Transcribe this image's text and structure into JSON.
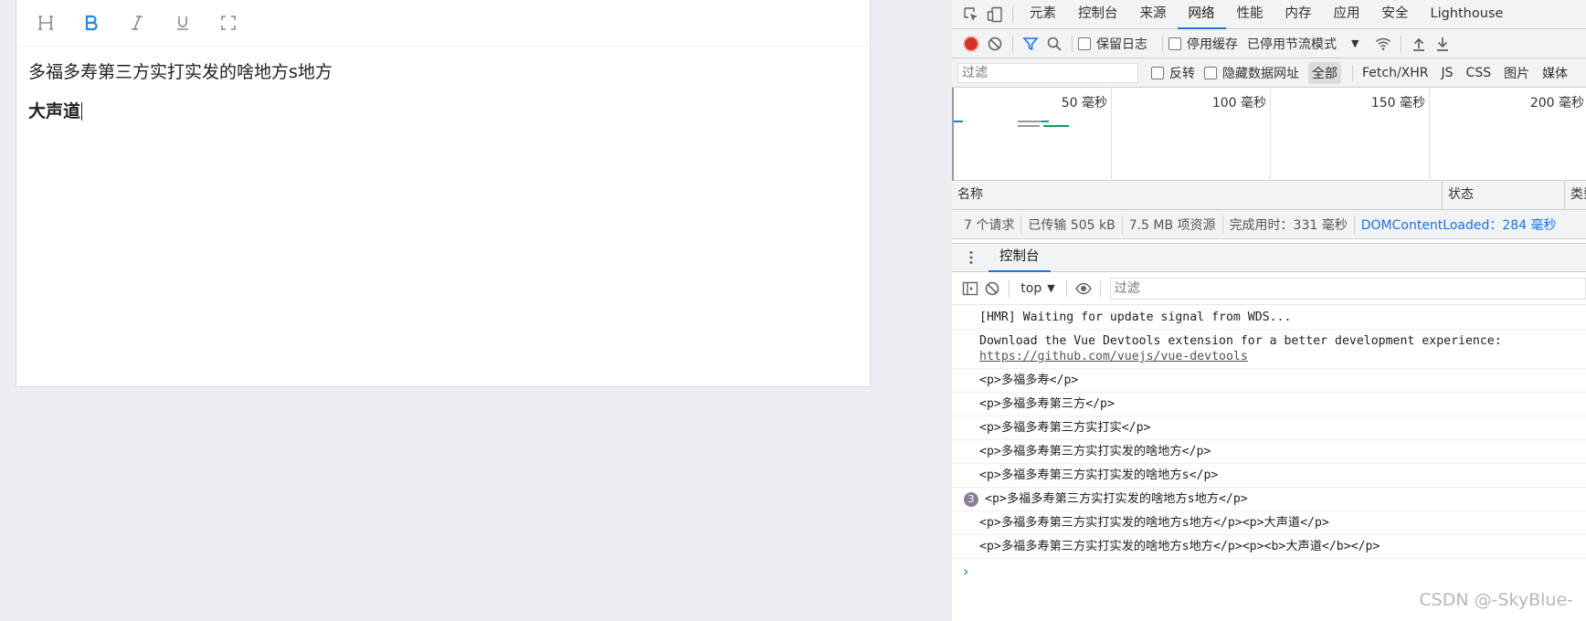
{
  "editor": {
    "toolbar": [
      {
        "icon": "heading-icon",
        "color": "#888888",
        "active": false
      },
      {
        "icon": "bold-icon",
        "color": "#1e88e5",
        "active": true
      },
      {
        "icon": "italic-icon",
        "color": "#888888",
        "active": false
      },
      {
        "icon": "underline-icon",
        "color": "#888888",
        "active": false
      },
      {
        "icon": "fullscreen-icon",
        "color": "#888888",
        "active": false
      }
    ],
    "paragraph_1": "多福多寿第三方实打实发的啥地方s地方",
    "paragraph_2_bold": "大声道"
  },
  "devtools": {
    "tabs": [
      "元素",
      "控制台",
      "来源",
      "网络",
      "性能",
      "内存",
      "应用",
      "安全",
      "Lighthouse"
    ],
    "active_tab": "网络",
    "net_toolbar": {
      "preserve_log": "保留日志",
      "disable_cache": "停用缓存",
      "throttle": "已停用节流模式"
    },
    "filter": {
      "placeholder": "过滤",
      "invert": "反转",
      "hide_data_urls": "隐藏数据网址",
      "types": [
        "全部",
        "Fetch/XHR",
        "JS",
        "CSS",
        "图片",
        "媒体"
      ]
    },
    "timeline": {
      "ticks": [
        "50 毫秒",
        "100 毫秒",
        "150 毫秒",
        "200 毫秒"
      ]
    },
    "columns": {
      "name": "名称",
      "status": "状态",
      "type": "类型"
    },
    "summary": {
      "requests": "7 个请求",
      "transferred": "已传输 505 kB",
      "resources": "7.5 MB 项资源",
      "finish": "完成用时：331 毫秒",
      "dom_loaded": "DOMContentLoaded：284 毫秒"
    },
    "drawer_tab": "控制台",
    "console": {
      "context": "top",
      "filter_placeholder": "过滤",
      "messages": [
        {
          "text": "[HMR] Waiting for update signal from WDS..."
        },
        {
          "text": "Download the Vue Devtools extension for a better development experience:",
          "link": "https://github.com/vuejs/vue-devtools"
        },
        {
          "text": "<p>多福多寿</p>"
        },
        {
          "text": "<p>多福多寿第三方</p>"
        },
        {
          "text": "<p>多福多寿第三方实打实</p>"
        },
        {
          "text": "<p>多福多寿第三方实打实发的啥地方</p>"
        },
        {
          "text": "<p>多福多寿第三方实打实发的啥地方s</p>"
        },
        {
          "text": "<p>多福多寿第三方实打实发的啥地方s地方</p>",
          "count": "3"
        },
        {
          "text": "<p>多福多寿第三方实打实发的啥地方s地方</p><p>大声道</p>"
        },
        {
          "text": "<p>多福多寿第三方实打实发的啥地方s地方</p><p><b>大声道</b></p>"
        }
      ]
    }
  },
  "watermark": "CSDN @-SkyBlue-"
}
